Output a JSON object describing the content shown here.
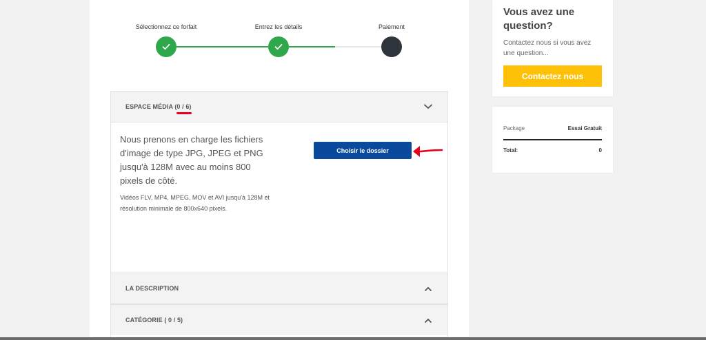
{
  "stepper": {
    "steps": [
      {
        "label": "Sélectionnez ce forfait",
        "state": "done"
      },
      {
        "label": "Entrez les détails",
        "state": "done"
      },
      {
        "label": "Paiement",
        "state": "current"
      }
    ]
  },
  "media": {
    "title_prefix": "ESPACE MÉDIA ",
    "count": "(0 / 6)",
    "description": "Nous prenons en charge les fichiers d'image de type JPG, JPEG et PNG jusqu'à 128M avec au moins 800 pixels de côté.",
    "video_note": "Vidéos FLV, MP4, MPEG, MOV et AVI jusqu'à 128M et résolution minimale de 800x640 pixels.",
    "choose_button": "Choisir le dossier"
  },
  "description_panel": {
    "title": "LA DESCRIPTION"
  },
  "category_panel": {
    "title": "CATÉGORIE ( 0 / 5)"
  },
  "sidebar": {
    "question_title": "Vous avez une question?",
    "question_text": "Contactez nous si vous avez une question...",
    "contact_button": "Contactez nous",
    "summary": {
      "package_label": "Package",
      "package_value": "Essai Gratuit",
      "total_label": "Total:",
      "total_value": "0"
    }
  },
  "colors": {
    "step_done": "#2ea84a",
    "step_current": "#2f353d",
    "primary_button": "#0a4a9c",
    "contact_button": "#ffc107",
    "annotation": "#e8001c"
  }
}
